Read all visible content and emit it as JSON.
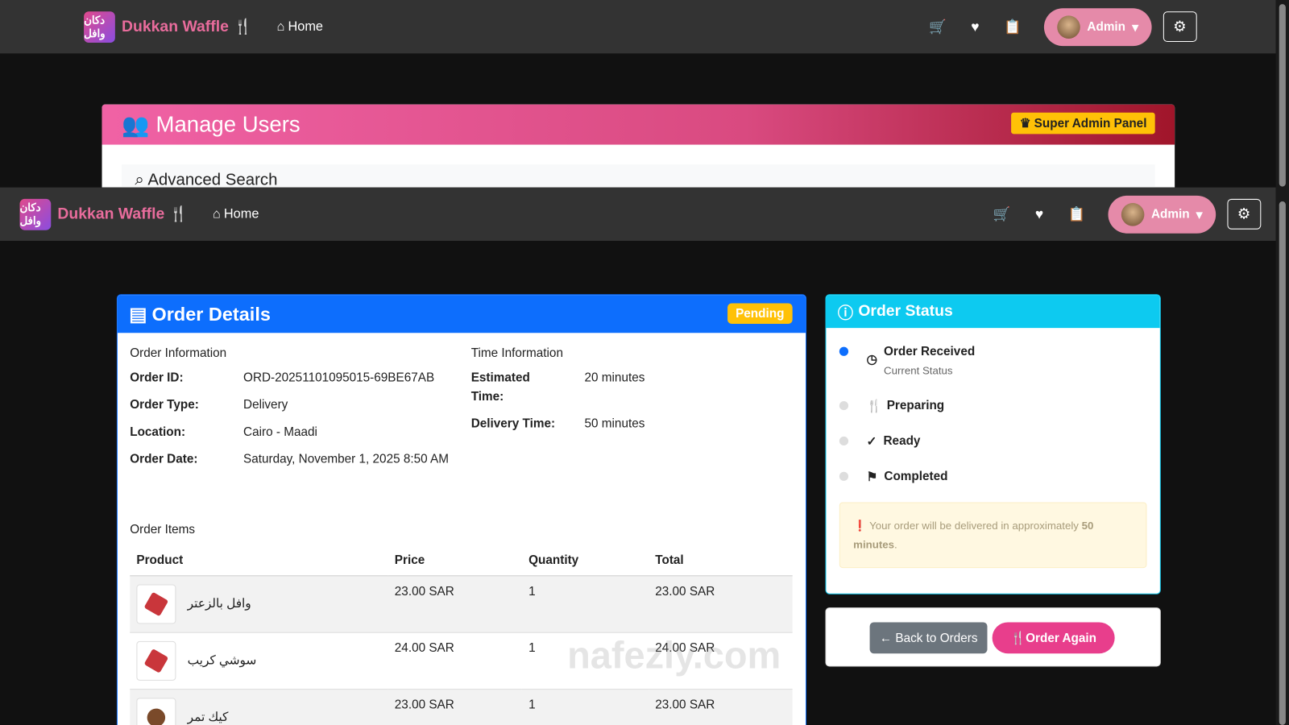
{
  "nav": {
    "logo_text": "دكان وافل",
    "brand": "Dukkan Waffle",
    "home": "Home",
    "admin": "Admin"
  },
  "manage": {
    "title": "Manage Users",
    "super": "Super Admin Panel",
    "search": "Advanced Search"
  },
  "order": {
    "title": "Order Details",
    "status_badge": "Pending",
    "info_title": "Order Information",
    "id_label": "Order ID:",
    "id": "ORD-20251101095015-69BE67AB",
    "type_label": "Order Type:",
    "type": "Delivery",
    "loc_label": "Location:",
    "loc": "Cairo - Maadi",
    "date_label": "Order Date:",
    "date": "Saturday, November 1, 2025 8:50 AM",
    "time_title": "Time Information",
    "est_label": "Estimated Time:",
    "est": "20 minutes",
    "del_label": "Delivery Time:",
    "del": "50 minutes",
    "items_title": "Order Items",
    "columns": [
      "Product",
      "Price",
      "Quantity",
      "Total"
    ],
    "items": [
      {
        "name": "وافل بالزعتر",
        "price": "23.00 SAR",
        "qty": "1",
        "total": "23.00 SAR"
      },
      {
        "name": "سوشي كريب",
        "price": "24.00 SAR",
        "qty": "1",
        "total": "24.00 SAR"
      },
      {
        "name": "كيك تمر",
        "price": "23.00 SAR",
        "qty": "1",
        "total": "23.00 SAR"
      }
    ]
  },
  "status": {
    "title": "Order Status",
    "steps": [
      {
        "label": "Order Received",
        "sub": "Current Status"
      },
      {
        "label": "Preparing"
      },
      {
        "label": "Ready"
      },
      {
        "label": "Completed"
      }
    ],
    "alert_text": "Your order will be delivered in approximately",
    "alert_bold": "50 minutes",
    "alert_end": ".",
    "back": "Back to Orders",
    "again": "Order Again"
  },
  "watermark": "nafezly.com"
}
